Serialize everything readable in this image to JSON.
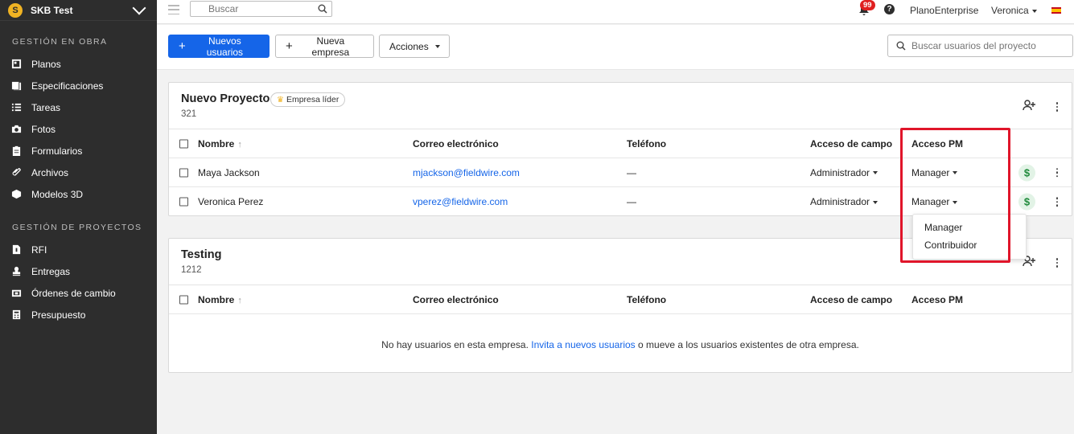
{
  "sidebar": {
    "org_name": "SKB Test",
    "logo_letter": "S",
    "sections": [
      {
        "title": "GESTIÓN EN OBRA",
        "items": [
          {
            "label": "Planos",
            "icon": "plans-icon"
          },
          {
            "label": "Especificaciones",
            "icon": "specifications-icon"
          },
          {
            "label": "Tareas",
            "icon": "tasks-icon"
          },
          {
            "label": "Fotos",
            "icon": "camera-icon"
          },
          {
            "label": "Formularios",
            "icon": "clipboard-icon"
          },
          {
            "label": "Archivos",
            "icon": "paperclip-icon"
          },
          {
            "label": "Modelos 3D",
            "icon": "cube-icon"
          }
        ]
      },
      {
        "title": "GESTIÓN DE PROYECTOS",
        "items": [
          {
            "label": "RFI",
            "icon": "rfi-icon"
          },
          {
            "label": "Entregas",
            "icon": "stamp-icon"
          },
          {
            "label": "Órdenes de cambio",
            "icon": "change-order-icon"
          },
          {
            "label": "Presupuesto",
            "icon": "calculator-icon"
          }
        ]
      }
    ]
  },
  "topbar": {
    "search_placeholder": "Buscar",
    "notifications_count": "99",
    "help_label": "?",
    "plan_label": "PlanoEnterprise",
    "user_name": "Veronica"
  },
  "actions": {
    "new_users_label": "Nuevos usuarios",
    "new_company_label": "Nueva empresa",
    "actions_label": "Acciones",
    "project_search_placeholder": "Buscar usuarios del proyecto"
  },
  "columns": {
    "name": "Nombre",
    "email": "Correo electrónico",
    "phone": "Teléfono",
    "field_access": "Acceso de campo",
    "pm_access": "Acceso PM"
  },
  "companies": [
    {
      "name": "Nuevo Proyecto",
      "badge": "Empresa líder",
      "count": "321",
      "users": [
        {
          "name": "Maya Jackson",
          "email": "mjackson@fieldwire.com",
          "phone": "—",
          "field_access": "Administrador",
          "pm_access": "Manager"
        },
        {
          "name": "Veronica Perez",
          "email": "vperez@fieldwire.com",
          "phone": "—",
          "field_access": "Administrador",
          "pm_access": "Manager"
        }
      ]
    },
    {
      "name": "Testing",
      "count": "1212",
      "empty_message_before": "No hay usuarios en esta empresa.",
      "empty_message_link": "Invita a nuevos usuarios",
      "empty_message_after": "o mueve a los usuarios existentes de otra empresa."
    }
  ],
  "pm_dropdown": {
    "options": [
      "Manager",
      "Contribuidor"
    ]
  },
  "colors": {
    "sidebar_bg": "#2d2d2d",
    "primary": "#1565e8",
    "highlight": "#e0152a",
    "notification": "#e02020"
  }
}
